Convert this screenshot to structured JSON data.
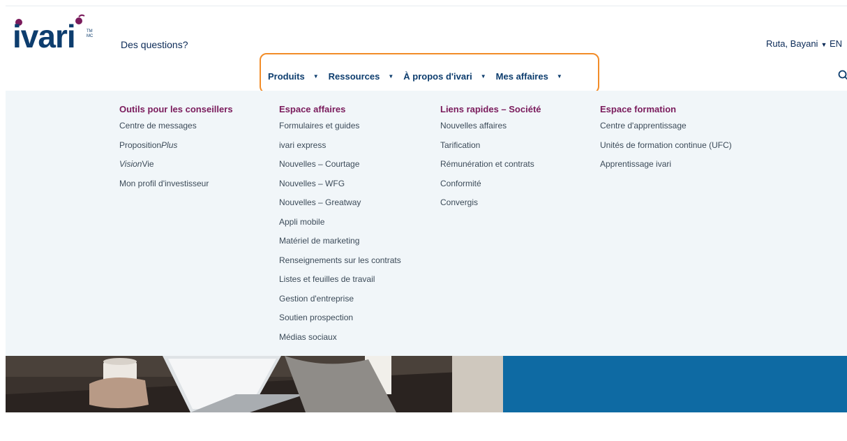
{
  "brand": {
    "name": "ivari",
    "trademark": "TM MC",
    "colors": {
      "plum": "#7a1b5c",
      "navy": "#0d3d6e",
      "highlight": "#f28c28",
      "panel": "#f1f6f9",
      "blue": "#0e6aa3"
    }
  },
  "header": {
    "help_link": "Des questions?",
    "user_name": "Ruta, Bayani",
    "language": "EN"
  },
  "nav": {
    "items": [
      {
        "label": "Produits"
      },
      {
        "label": "Ressources"
      },
      {
        "label": "À propos d'ivari"
      },
      {
        "label": "Mes affaires"
      }
    ],
    "search_icon": "search-icon"
  },
  "mega_menu": {
    "columns": [
      {
        "title": "Outils pour les conseillers",
        "links": [
          "Centre de messages",
          "PropositionPlus",
          "VisionVie",
          "Mon profil d'investisseur"
        ]
      },
      {
        "title": "Espace affaires",
        "links": [
          "Formulaires et guides",
          "ivari express",
          "Nouvelles – Courtage",
          "Nouvelles – WFG",
          "Nouvelles – Greatway",
          "Appli mobile",
          "Matériel de marketing",
          "Renseignements sur les contrats",
          "Listes et feuilles de travail",
          "Gestion d'entreprise",
          "Soutien prospection",
          "Médias sociaux"
        ]
      },
      {
        "title": "Liens rapides – Société",
        "links": [
          "Nouvelles affaires",
          "Tarification",
          "Rémunération et contrats",
          "Conformité",
          "Convergis"
        ]
      },
      {
        "title": "Espace formation",
        "links": [
          "Centre d'apprentissage",
          "Unités de formation continue (UFC)",
          "Apprentissage ivari"
        ]
      }
    ]
  }
}
